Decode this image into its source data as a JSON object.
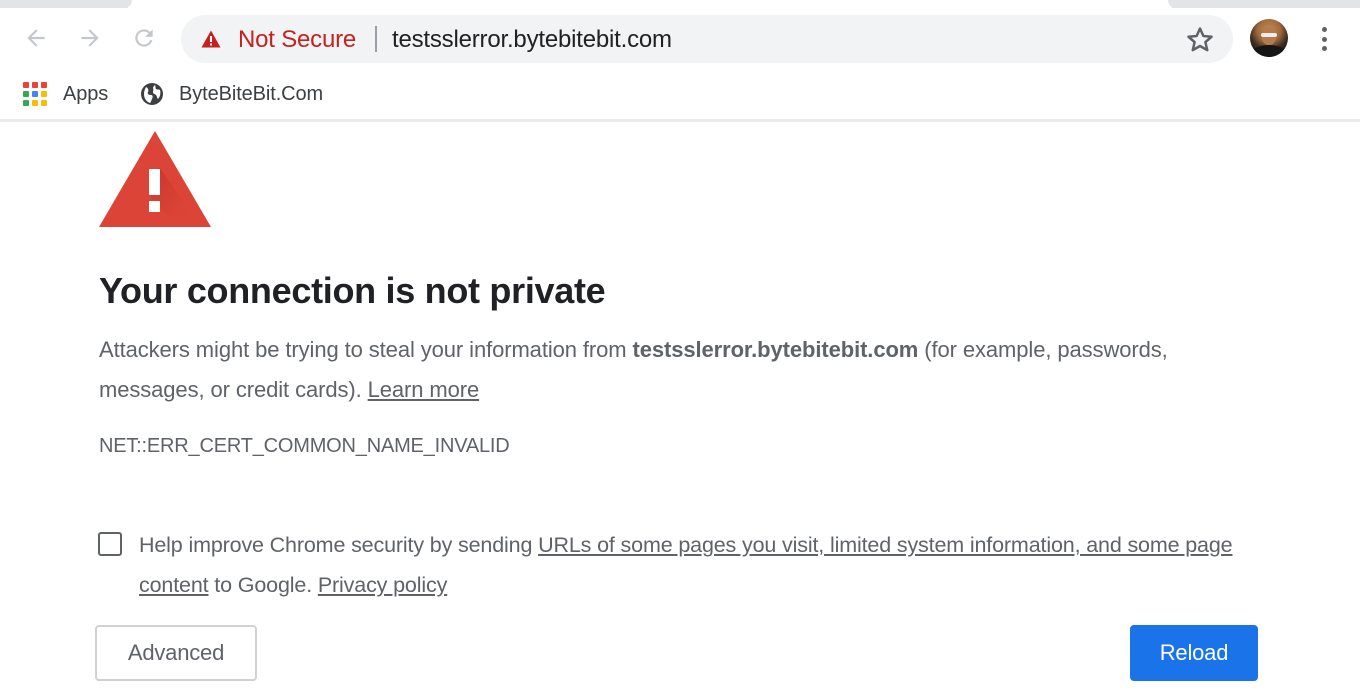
{
  "browser": {
    "toolbar": {
      "back_icon": "arrow-left-icon",
      "forward_icon": "arrow-right-icon",
      "reload_icon": "reload-icon",
      "security_icon": "warning-triangle-icon",
      "security_label": "Not Secure",
      "url": "testsslerror.bytebitebit.com",
      "bookmark_icon": "star-icon",
      "avatar": "profile-avatar",
      "menu_icon": "vertical-dots-icon"
    },
    "bookmarks": [
      {
        "label": "Apps",
        "icon": "apps-grid-icon"
      },
      {
        "label": "ByteBiteBit.Com",
        "icon": "globe-icon"
      }
    ]
  },
  "interstitial": {
    "icon": "warning-triangle-icon",
    "headline": "Your connection is not private",
    "explanation": {
      "prefix": "Attackers might be trying to steal your information from ",
      "host": "testsslerror.bytebitebit.com",
      "suffix": " (for example, passwords, messages, or credit cards). ",
      "learn_more": "Learn more"
    },
    "error_code": "NET::ERR_CERT_COMMON_NAME_INVALID",
    "optin": {
      "checked": false,
      "prefix": "Help improve Chrome security by sending ",
      "link1": "URLs of some pages you visit, limited system information, and some page content",
      "middle": " to Google. ",
      "link2": "Privacy policy"
    },
    "buttons": {
      "advanced": "Advanced",
      "reload": "Reload"
    }
  },
  "colors": {
    "danger_red": "#c5221f",
    "warning_triangle": "#db4437",
    "primary_blue": "#1a73e8",
    "body_text": "#5f6368",
    "headline_text": "#202124",
    "omnibox_bg": "#f1f3f4"
  }
}
